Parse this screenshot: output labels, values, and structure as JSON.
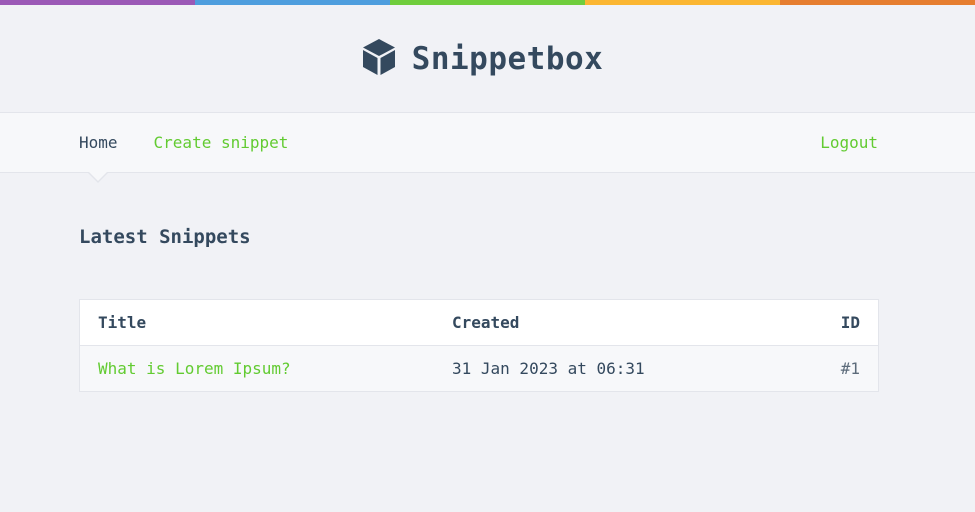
{
  "colors": {
    "rainbow": [
      "#9b59b6",
      "#4e9ede",
      "#6fcd3c",
      "#fbb632",
      "#e67e30"
    ],
    "text": "#34495e",
    "accent": "#62cb31",
    "background": "#f1f2f6"
  },
  "header": {
    "logo_icon": "cube-icon",
    "title": "Snippetbox"
  },
  "nav": {
    "home": "Home",
    "create": "Create snippet",
    "logout": "Logout"
  },
  "main": {
    "heading": "Latest Snippets",
    "table": {
      "columns": [
        "Title",
        "Created",
        "ID"
      ],
      "rows": [
        {
          "title": "What is Lorem Ipsum?",
          "created": "31 Jan 2023 at 06:31",
          "id": "#1"
        }
      ]
    }
  }
}
